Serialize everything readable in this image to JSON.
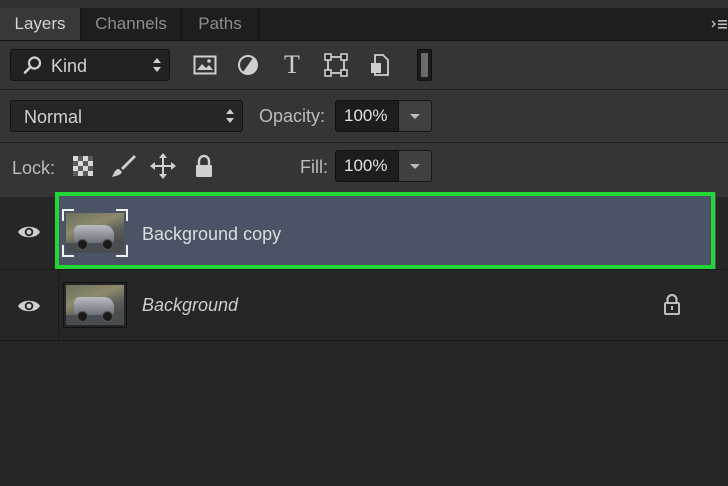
{
  "tabs": [
    {
      "label": "Layers",
      "active": true
    },
    {
      "label": "Channels",
      "active": false
    },
    {
      "label": "Paths",
      "active": false
    }
  ],
  "filter": {
    "kind_label": "Kind",
    "icons": [
      "image-filter-icon",
      "adjustment-filter-icon",
      "type-filter-icon",
      "shape-filter-icon",
      "smart-object-filter-icon"
    ],
    "type_glyph": "T"
  },
  "blend": {
    "mode": "Normal",
    "opacity_label": "Opacity:",
    "opacity_value": "100%"
  },
  "lock": {
    "label": "Lock:",
    "icons": [
      "lock-transparent-pixels-icon",
      "lock-image-pixels-icon",
      "lock-position-icon",
      "lock-all-icon"
    ],
    "fill_label": "Fill:",
    "fill_value": "100%"
  },
  "layers": [
    {
      "name": "Background copy",
      "selected": true,
      "italic": false,
      "locked": false,
      "visible": true
    },
    {
      "name": "Background",
      "selected": false,
      "italic": true,
      "locked": true,
      "visible": true
    }
  ],
  "colors": {
    "selection": "#4b5466",
    "highlight_box": "#22d633",
    "panel": "#353535",
    "list_bg": "#262626"
  }
}
